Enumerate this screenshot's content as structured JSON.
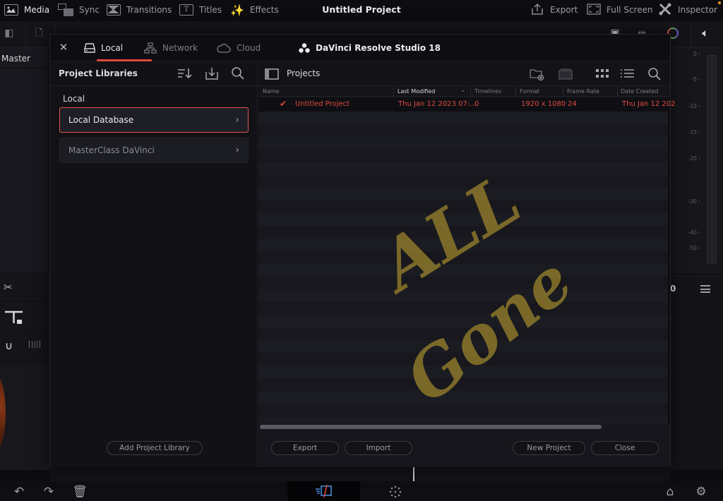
{
  "topbar": {
    "items": [
      {
        "label": "Media",
        "icon": "media-icon",
        "active": true
      },
      {
        "label": "Sync",
        "icon": "sync-icon",
        "active": false
      },
      {
        "label": "Transitions",
        "icon": "transitions-icon",
        "active": false
      },
      {
        "label": "Titles",
        "icon": "titles-icon",
        "active": false
      },
      {
        "label": "Effects",
        "icon": "effects-icon",
        "active": false
      }
    ],
    "project_title": "Untitled Project",
    "right_items": [
      {
        "label": "Export",
        "icon": "export-icon"
      },
      {
        "label": "Full Screen",
        "icon": "fullscreen-icon"
      },
      {
        "label": "Inspector",
        "icon": "inspector-icon"
      }
    ]
  },
  "background": {
    "bin_label": "Master",
    "timecode_fragment": "0",
    "meter_scale": [
      "0 -",
      "-5 -",
      "-10 -",
      "-15 -",
      "-20 -",
      "-30 -",
      "-40 -",
      "-50 -"
    ]
  },
  "modal": {
    "tabs": [
      {
        "label": "Local",
        "icon": "drive-icon",
        "active": true
      },
      {
        "label": "Network",
        "icon": "network-icon",
        "active": false
      },
      {
        "label": "Cloud",
        "icon": "cloud-icon",
        "active": false
      }
    ],
    "brand": "DaVinci Resolve Studio 18",
    "libraries": {
      "title": "Project Libraries",
      "section": "Local",
      "items": [
        {
          "label": "Local Database",
          "selected": true
        },
        {
          "label": "MasterClass DaVinci",
          "selected": false
        }
      ],
      "add_button": "Add Project Library"
    },
    "projects": {
      "title": "Projects",
      "columns": [
        "Name",
        "Last Modified",
        "Timelines",
        "Format",
        "Frame Rate",
        "Date Created"
      ],
      "sort_column": "Last Modified",
      "rows": [
        {
          "name": "Untitled Project",
          "last_modified": "Thu Jan 12 2023 07:...",
          "timelines": "0",
          "format": "1920 x 1080",
          "frame_rate": "24",
          "date_created": "Thu Jan 12 202",
          "current": true
        }
      ],
      "watermark_line1": "ALL",
      "watermark_line2": "Gone",
      "buttons": {
        "export": "Export",
        "import": "Import",
        "new_project": "New Project",
        "close": "Close"
      }
    }
  },
  "colors": {
    "accent_red": "#e04a3f",
    "watermark_yellow": "#b59a2e",
    "background": "#111116"
  }
}
